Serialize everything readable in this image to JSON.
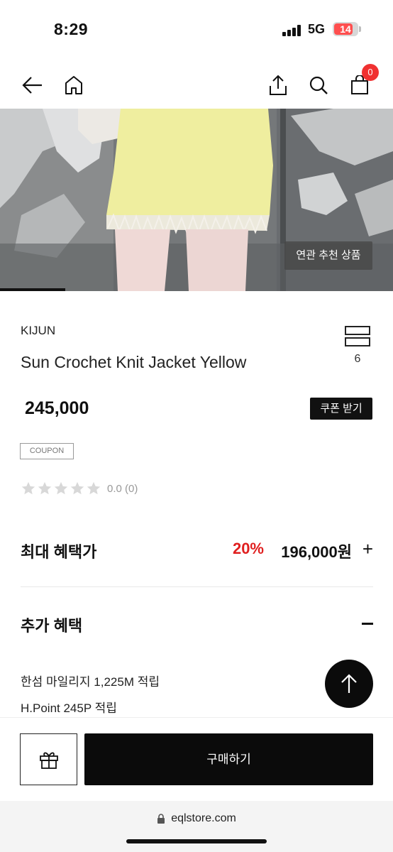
{
  "status": {
    "time": "8:29",
    "network": "5G",
    "battery": "14"
  },
  "nav": {
    "cart_count": "0"
  },
  "hero": {
    "related_label": "연관 추천 상품"
  },
  "product": {
    "brand": "KIJUN",
    "name": "Sun Crochet Knit Jacket Yellow",
    "compare_count": "6",
    "price": "245,000",
    "coupon_button": "쿠폰 받기",
    "coupon_tag": "COUPON",
    "rating_text": "0.0 (0)",
    "rating_value": 0
  },
  "benefits": {
    "max_label": "최대 혜택가",
    "max_percent": "20%",
    "max_price": "196,000원",
    "plus": "+",
    "extra_label": "추가 혜택",
    "lines": [
      "한섬 마일리지 1,225M 적립",
      "H.Point 245P 적립"
    ]
  },
  "actions": {
    "buy_label": "구매하기"
  },
  "browser": {
    "url": "eqlstore.com"
  },
  "colors": {
    "accent_red": "#e01f1f",
    "badge_red": "#f03131",
    "skirt_yellow": "#efee9f"
  },
  "icons": [
    "back-arrow-icon",
    "home-icon",
    "share-icon",
    "search-icon",
    "cart-icon",
    "compare-icon",
    "star-icon",
    "arrow-up-icon",
    "gift-icon",
    "lock-icon"
  ]
}
